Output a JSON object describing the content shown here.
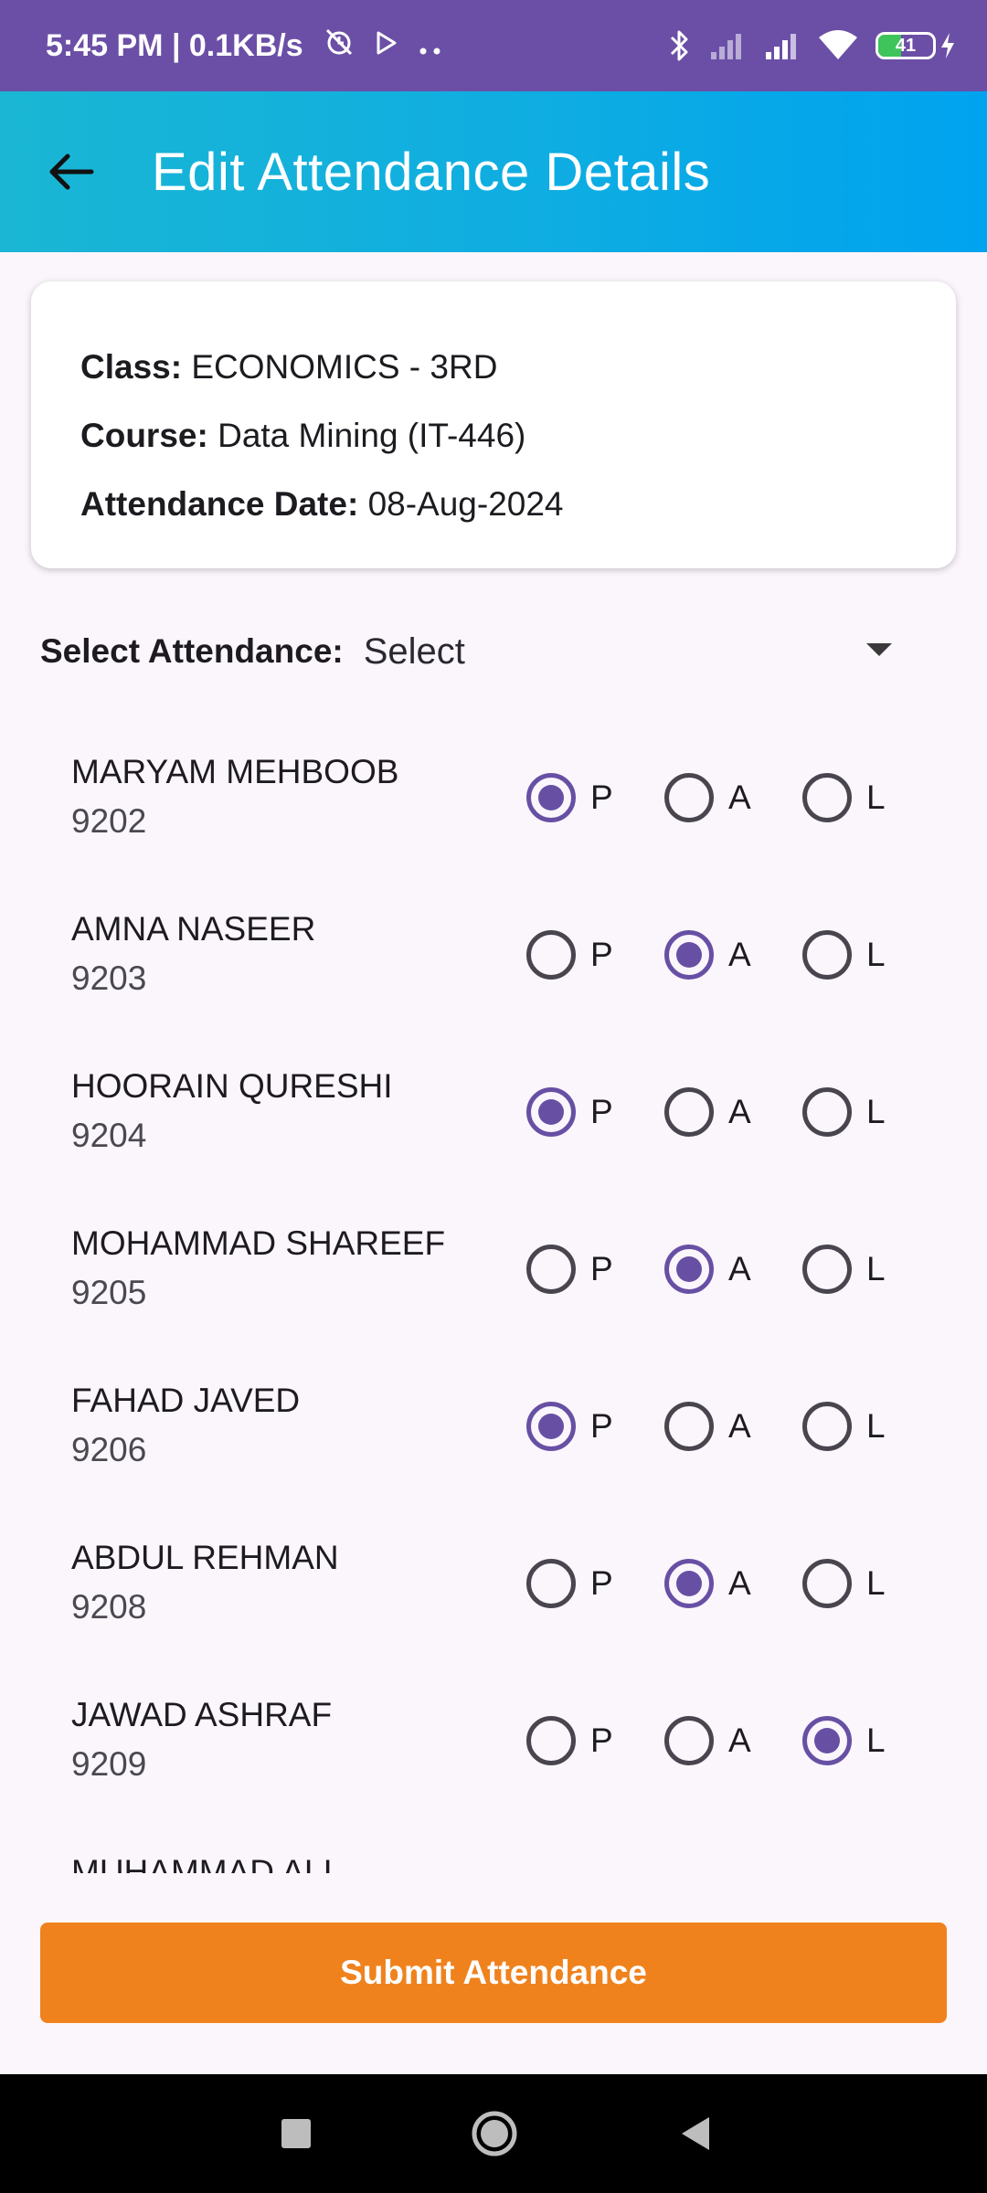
{
  "status_bar": {
    "time_speed": "5:45 PM | 0.1KB/s",
    "battery_percent": "41",
    "battery_level": 0.41
  },
  "app_bar": {
    "title": "Edit Attendance Details"
  },
  "info": {
    "class_label": "Class:",
    "class_value": "ECONOMICS - 3RD",
    "course_label": "Course:",
    "course_value": "Data Mining (IT-446)",
    "date_label": "Attendance Date:",
    "date_value": "08-Aug-2024"
  },
  "select": {
    "label": "Select Attendance:",
    "value": "Select"
  },
  "options": {
    "p": "P",
    "a": "A",
    "l": "L"
  },
  "students": [
    {
      "name": "MARYAM MEHBOOB",
      "id": "9202",
      "status": "P"
    },
    {
      "name": "AMNA NASEER",
      "id": "9203",
      "status": "A"
    },
    {
      "name": "HOORAIN QURESHI",
      "id": "9204",
      "status": "P"
    },
    {
      "name": "MOHAMMAD SHAREEF",
      "id": "9205",
      "status": "A"
    },
    {
      "name": "FAHAD JAVED",
      "id": "9206",
      "status": "P"
    },
    {
      "name": "ABDUL REHMAN",
      "id": "9208",
      "status": "A"
    },
    {
      "name": "JAWAD ASHRAF",
      "id": "9209",
      "status": "L"
    },
    {
      "name": "MUHAMMAD ALI",
      "id": "",
      "status": ""
    }
  ],
  "submit_label": "Submit Attendance",
  "colors": {
    "status_bar": "#6b4fa6",
    "radio_checked": "#6750a4",
    "submit": "#f0821e",
    "app_bar_start": "#1ab6d4",
    "app_bar_end": "#00a3ef"
  }
}
